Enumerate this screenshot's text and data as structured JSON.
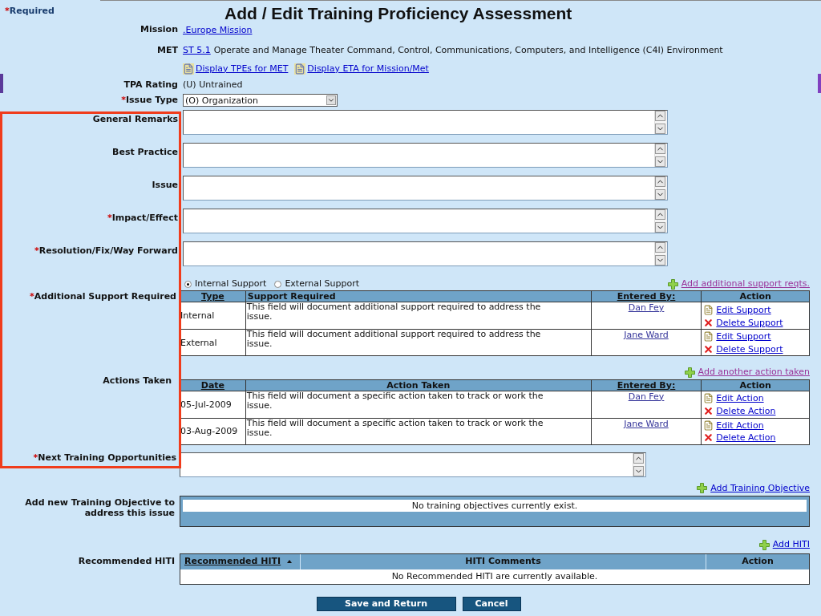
{
  "required_note": {
    "mark": "*",
    "text": "Required"
  },
  "title": "Add / Edit Training Proficiency Assessment",
  "mission": {
    "label": "Mission",
    "link": ".Europe Mission"
  },
  "met": {
    "label": "MET",
    "link": "ST 5.1",
    "text": "Operate and Manage Theater Command, Control, Communications, Computers, and Intelligence (C4I) Environment"
  },
  "doc_links": [
    "Display TPEs for MET",
    "Display ETA for Mission/Met"
  ],
  "tpa_rating": {
    "label": "TPA Rating",
    "value": "(U) Untrained"
  },
  "issue_type": {
    "label": "Issue Type",
    "required": true,
    "value": "(O) Organization"
  },
  "text_fields": [
    {
      "label": "General Remarks",
      "required": false
    },
    {
      "label": "Best Practice",
      "required": false
    },
    {
      "label": "Issue",
      "required": false
    },
    {
      "label": "Impact/Effect",
      "required": true
    },
    {
      "label": "Resolution/Fix/Way Forward",
      "required": true
    }
  ],
  "support": {
    "label": "Additional Support Required",
    "required": true,
    "radios": [
      {
        "label": "Internal Support",
        "selected": true
      },
      {
        "label": "External Support",
        "selected": false
      }
    ],
    "add_link": {
      "parts": [
        "Add",
        "additional support reqts."
      ],
      "visited": true
    },
    "columns": [
      {
        "label": "Type",
        "sortable": true
      },
      {
        "label": "Support Required",
        "sortable": false
      },
      {
        "label": "Entered By:",
        "sortable": true
      },
      {
        "label": "Action",
        "sortable": false
      }
    ],
    "rows": [
      {
        "col1": "Internal",
        "text": "This field will document additional support required to address the issue.",
        "entered_by": "Dan Fey",
        "actions": [
          {
            "kind": "edit",
            "label": "Edit Support"
          },
          {
            "kind": "delete",
            "label": "Delete Support"
          }
        ]
      },
      {
        "col1": "External",
        "text": "This field will document additional support required to address the issue.",
        "entered_by": "Jane Ward",
        "actions": [
          {
            "kind": "edit",
            "label": "Edit Support"
          },
          {
            "kind": "delete",
            "label": "Delete Support"
          }
        ]
      }
    ]
  },
  "actions_taken": {
    "label": "Actions Taken",
    "required": false,
    "add_link": {
      "parts": [
        "Add another action taken"
      ],
      "visited": true
    },
    "columns": [
      {
        "label": "Date",
        "sortable": true
      },
      {
        "label": "Action Taken",
        "sortable": false
      },
      {
        "label": "Entered By:",
        "sortable": true
      },
      {
        "label": "Action",
        "sortable": false
      }
    ],
    "rows": [
      {
        "col1": "05-Jul-2009",
        "text": "This field will document a specific action taken to track or work the issue.",
        "entered_by": "Dan Fey",
        "actions": [
          {
            "kind": "edit",
            "label": "Edit Action"
          },
          {
            "kind": "delete",
            "label": "Delete Action"
          }
        ]
      },
      {
        "col1": "03-Aug-2009",
        "text": "This field will document a specific action taken to track or work the issue.",
        "entered_by": "Jane Ward",
        "actions": [
          {
            "kind": "edit",
            "label": "Edit Action"
          },
          {
            "kind": "delete",
            "label": "Delete Action"
          }
        ]
      }
    ]
  },
  "next_training": {
    "label": "Next Training Opportunities",
    "required": true
  },
  "training_objective": {
    "label": "Add new Training Objective to address this issue",
    "add_link": {
      "parts": [
        "Add Training Objective"
      ],
      "visited": false
    },
    "empty_text": "No training objectives currently exist."
  },
  "hiti": {
    "label": "Recommended HITI",
    "add_link": {
      "parts": [
        "Add HITI"
      ],
      "visited": false
    },
    "columns": [
      {
        "label": "Recommended HITI",
        "sortable": true,
        "sorted_ascending": true
      },
      {
        "label": "HITI Comments",
        "sortable": false
      },
      {
        "label": "Action",
        "sortable": false
      }
    ],
    "empty_text": "No Recommended HITI are currently available."
  },
  "buttons": [
    "Save and Return",
    "Cancel"
  ]
}
